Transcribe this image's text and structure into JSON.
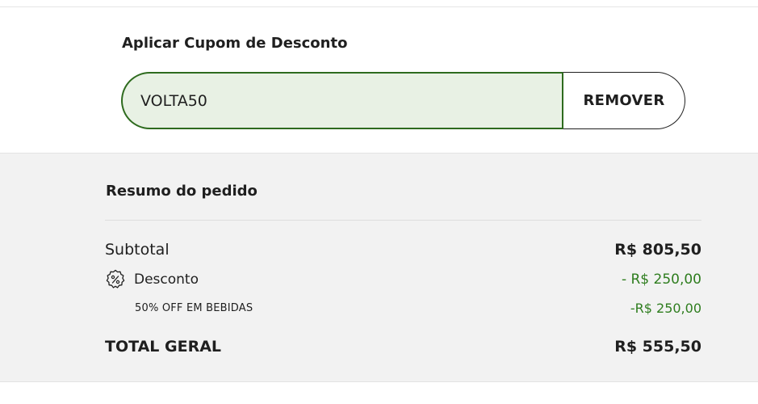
{
  "coupon": {
    "title": "Aplicar Cupom de Desconto",
    "code": "VOLTA50",
    "remove_label": "REMOVER",
    "accent_color": "#2e6b1e",
    "input_bg": "#e8f1e4"
  },
  "summary": {
    "title": "Resumo do pedido",
    "subtotal_label": "Subtotal",
    "subtotal_value": "R$ 805,50",
    "discount_label": "Desconto",
    "discount_icon": "percent-badge-icon",
    "discount_value": "- R$ 250,00",
    "promo_label": "50% OFF EM BEBIDAS",
    "promo_value": "-R$ 250,00",
    "total_label": "TOTAL GERAL",
    "total_value": "R$ 555,50",
    "discount_color": "#2e7d1e"
  }
}
